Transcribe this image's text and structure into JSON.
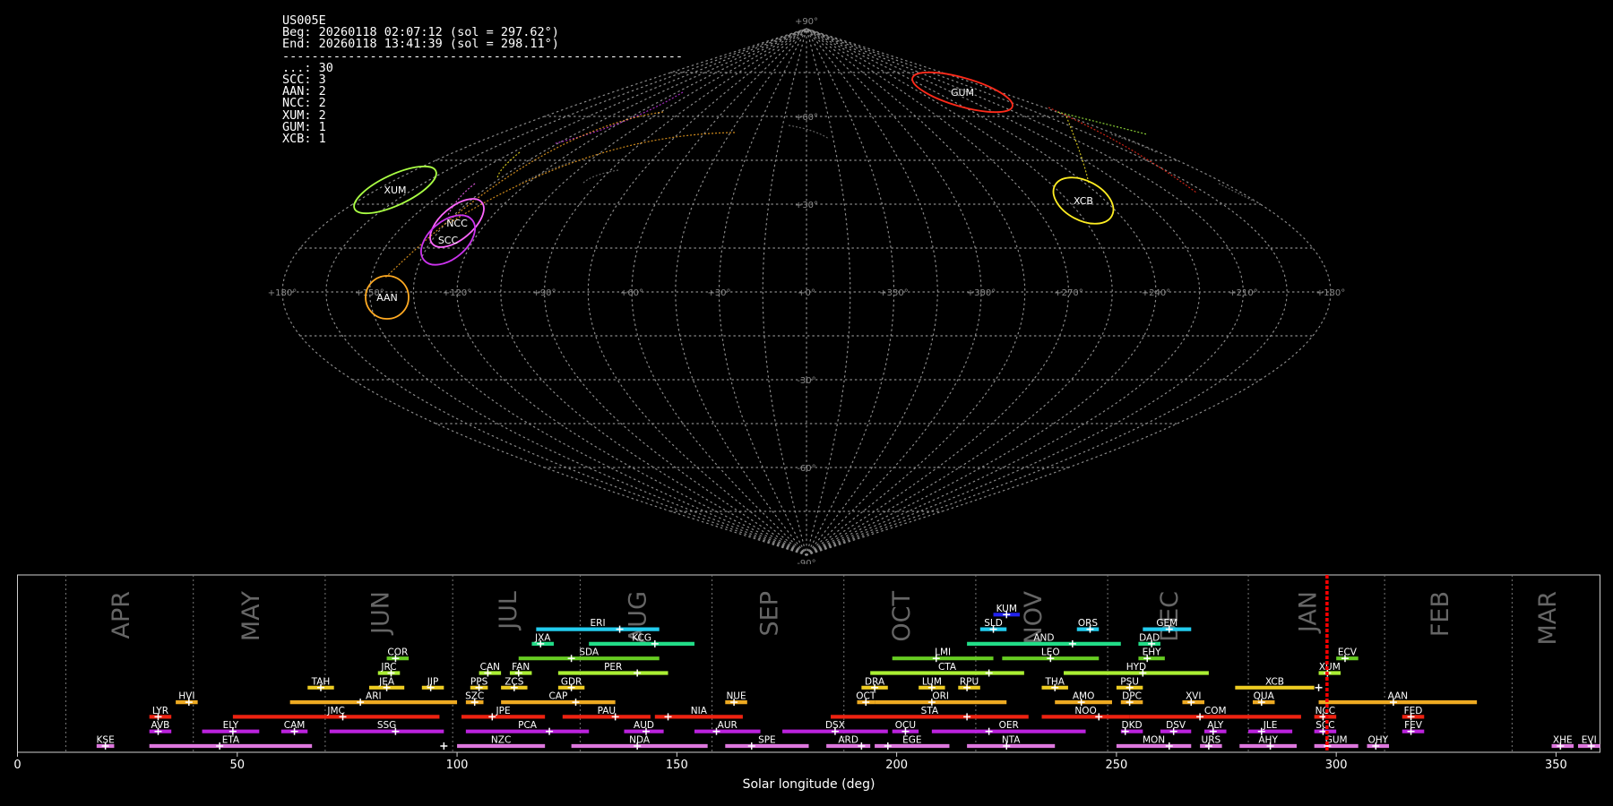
{
  "info": {
    "station": "US005E",
    "begin": "Beg: 20260118 02:07:12 (sol = 297.62°)",
    "end": "End: 20260118 13:41:39 (sol = 298.11°)",
    "separator": "-------------------------------------------------------",
    "counts": [
      {
        "code": "...",
        "count": 30
      },
      {
        "code": "SCC",
        "count": 3
      },
      {
        "code": "AAN",
        "count": 2
      },
      {
        "code": "NCC",
        "count": 2
      },
      {
        "code": "XUM",
        "count": 2
      },
      {
        "code": "GUM",
        "count": 1
      },
      {
        "code": "XCB",
        "count": 1
      }
    ]
  },
  "colors": {
    "background": "#000000",
    "grid": "#8a8a8a",
    "GUM": "#ff2a1a",
    "XCB": "#ffee22",
    "XUM": "#aaff44",
    "NCC": "#ff66ff",
    "SCC": "#cc33ee",
    "AAN": "#ffaa22",
    "sporadic": "#777777",
    "current": "#ff0000"
  },
  "sky_map": {
    "projection": "sinusoidal",
    "lon_labels": [
      "+180°",
      "+150°",
      "+120°",
      "+90°",
      "+60°",
      "+30°",
      "+0°",
      "+330°",
      "+300°",
      "+270°",
      "+240°",
      "+210°",
      "+180°"
    ],
    "lat_labels": [
      "+90°",
      "+60°",
      "+30°",
      "-30°",
      "-60°",
      "-90°"
    ],
    "showers": [
      {
        "code": "GUM",
        "lon": 238,
        "lat": 56
      },
      {
        "code": "XCB",
        "lon": 221,
        "lat": 27
      },
      {
        "code": "XUM",
        "lon": 163,
        "lat": 31
      },
      {
        "code": "NCC",
        "lon": 138,
        "lat": 18
      },
      {
        "code": "SCC",
        "lon": 140,
        "lat": 14
      },
      {
        "code": "AAN",
        "lon": 145,
        "lat": -1
      }
    ]
  },
  "chart_data": {
    "type": "timeline",
    "xlabel": "Solar longitude (deg)",
    "xlim": [
      0,
      360
    ],
    "xticks": [
      0,
      50,
      100,
      150,
      200,
      250,
      300,
      350
    ],
    "current_sol": 297.9,
    "months": [
      {
        "name": "APR",
        "start": 11
      },
      {
        "name": "MAY",
        "start": 40
      },
      {
        "name": "JUN",
        "start": 70
      },
      {
        "name": "JUL",
        "start": 99
      },
      {
        "name": "AUG",
        "start": 128
      },
      {
        "name": "SEP",
        "start": 158
      },
      {
        "name": "OCT",
        "start": 188
      },
      {
        "name": "NOV",
        "start": 218
      },
      {
        "name": "DEC",
        "start": 248
      },
      {
        "name": "JAN",
        "start": 280
      },
      {
        "name": "FEB",
        "start": 311
      },
      {
        "name": "MAR",
        "start": 340
      }
    ],
    "showers": [
      {
        "code": "KUM",
        "start": 222,
        "end": 228,
        "peak": 225,
        "row": 10,
        "color": "#2222ee"
      },
      {
        "code": "ERI",
        "start": 118,
        "end": 146,
        "peak": 137,
        "row": 9,
        "color": "#22ccee"
      },
      {
        "code": "SLD",
        "start": 219,
        "end": 225,
        "peak": 222,
        "row": 9,
        "color": "#22ccee"
      },
      {
        "code": "ORS",
        "start": 241,
        "end": 246,
        "peak": 244,
        "row": 9,
        "color": "#22ccee"
      },
      {
        "code": "GEM",
        "start": 256,
        "end": 267,
        "peak": 262,
        "row": 9,
        "color": "#22ccee"
      },
      {
        "code": "JXA",
        "start": 117,
        "end": 122,
        "peak": 119,
        "row": 8,
        "color": "#22dd88"
      },
      {
        "code": "KCG",
        "start": 130,
        "end": 154,
        "peak": 145,
        "row": 8,
        "color": "#22dd88"
      },
      {
        "code": "AND",
        "start": 216,
        "end": 251,
        "peak": 240,
        "row": 8,
        "color": "#22dd88"
      },
      {
        "code": "DAD",
        "start": 255,
        "end": 260,
        "peak": 258,
        "row": 8,
        "color": "#22dd88"
      },
      {
        "code": "COR",
        "start": 84,
        "end": 89,
        "peak": 86,
        "row": 7,
        "color": "#66cc22"
      },
      {
        "code": "SDA",
        "start": 114,
        "end": 146,
        "peak": 126,
        "row": 7,
        "color": "#66cc22"
      },
      {
        "code": "LMI",
        "start": 199,
        "end": 222,
        "peak": 209,
        "row": 7,
        "color": "#66cc22"
      },
      {
        "code": "LEO",
        "start": 224,
        "end": 246,
        "peak": 235,
        "row": 7,
        "color": "#66cc22"
      },
      {
        "code": "EHY",
        "start": 255,
        "end": 261,
        "peak": 257,
        "row": 7,
        "color": "#66cc22"
      },
      {
        "code": "ECV",
        "start": 300,
        "end": 305,
        "peak": 302,
        "row": 7,
        "color": "#66cc22"
      },
      {
        "code": "JRC",
        "start": 82,
        "end": 87,
        "peak": 85,
        "row": 6,
        "color": "#aaee33"
      },
      {
        "code": "CAN",
        "start": 105,
        "end": 110,
        "peak": 107,
        "row": 6,
        "color": "#aaee33"
      },
      {
        "code": "FAN",
        "start": 112,
        "end": 117,
        "peak": 114,
        "row": 6,
        "color": "#aaee33"
      },
      {
        "code": "PER",
        "start": 123,
        "end": 148,
        "peak": 141,
        "row": 6,
        "color": "#aaee33"
      },
      {
        "code": "CTA",
        "start": 194,
        "end": 229,
        "peak": 221,
        "row": 6,
        "color": "#aaee33"
      },
      {
        "code": "HYD",
        "start": 238,
        "end": 271,
        "peak": 256,
        "row": 6,
        "color": "#aaee33"
      },
      {
        "code": "XUM",
        "start": 296,
        "end": 301,
        "peak": 298,
        "row": 6,
        "color": "#aaee33"
      },
      {
        "code": "TAH",
        "start": 66,
        "end": 72,
        "peak": 69,
        "row": 5,
        "color": "#eecc22"
      },
      {
        "code": "JEA",
        "start": 80,
        "end": 88,
        "peak": 84,
        "row": 5,
        "color": "#eecc22"
      },
      {
        "code": "JIP",
        "start": 92,
        "end": 97,
        "peak": 94,
        "row": 5,
        "color": "#eecc22"
      },
      {
        "code": "PPS",
        "start": 103,
        "end": 107,
        "peak": 105,
        "row": 5,
        "color": "#eecc22"
      },
      {
        "code": "ZCS",
        "start": 110,
        "end": 116,
        "peak": 113,
        "row": 5,
        "color": "#eecc22"
      },
      {
        "code": "GDR",
        "start": 123,
        "end": 129,
        "peak": 126,
        "row": 5,
        "color": "#eecc22"
      },
      {
        "code": "DRA",
        "start": 192,
        "end": 198,
        "peak": 195,
        "row": 5,
        "color": "#eecc22"
      },
      {
        "code": "LUM",
        "start": 205,
        "end": 211,
        "peak": 208,
        "row": 5,
        "color": "#eecc22"
      },
      {
        "code": "RPU",
        "start": 214,
        "end": 219,
        "peak": 216,
        "row": 5,
        "color": "#eecc22"
      },
      {
        "code": "THA",
        "start": 233,
        "end": 239,
        "peak": 236,
        "row": 5,
        "color": "#eecc22"
      },
      {
        "code": "PSU",
        "start": 250,
        "end": 256,
        "peak": 253,
        "row": 5,
        "color": "#eecc22"
      },
      {
        "code": "XCB",
        "start": 277,
        "end": 295,
        "peak": 296,
        "row": 5,
        "color": "#eecc22"
      },
      {
        "code": "HVI",
        "start": 36,
        "end": 41,
        "peak": 39,
        "row": 4,
        "color": "#eeaa22"
      },
      {
        "code": "ARI",
        "start": 62,
        "end": 100,
        "peak": 78,
        "row": 4,
        "color": "#eeaa22"
      },
      {
        "code": "SZC",
        "start": 102,
        "end": 106,
        "peak": 104,
        "row": 4,
        "color": "#eeaa22"
      },
      {
        "code": "CAP",
        "start": 110,
        "end": 136,
        "peak": 127,
        "row": 4,
        "color": "#eeaa22"
      },
      {
        "code": "NUE",
        "start": 161,
        "end": 166,
        "peak": 163,
        "row": 4,
        "color": "#eeaa22"
      },
      {
        "code": "OCT",
        "start": 191,
        "end": 195,
        "peak": 193,
        "row": 4,
        "color": "#eeaa22"
      },
      {
        "code": "ORI",
        "start": 195,
        "end": 225,
        "peak": 208,
        "row": 4,
        "color": "#eeaa22"
      },
      {
        "code": "AMO",
        "start": 236,
        "end": 249,
        "peak": 242,
        "row": 4,
        "color": "#eeaa22"
      },
      {
        "code": "DPC",
        "start": 251,
        "end": 256,
        "peak": 253,
        "row": 4,
        "color": "#eeaa22"
      },
      {
        "code": "XVI",
        "start": 265,
        "end": 270,
        "peak": 267,
        "row": 4,
        "color": "#eeaa22"
      },
      {
        "code": "QUA",
        "start": 281,
        "end": 286,
        "peak": 283,
        "row": 4,
        "color": "#eeaa22"
      },
      {
        "code": "AAN",
        "start": 296,
        "end": 332,
        "peak": 313,
        "row": 4,
        "color": "#eeaa22"
      },
      {
        "code": "LYR",
        "start": 30,
        "end": 35,
        "peak": 32,
        "row": 3,
        "color": "#ee2211"
      },
      {
        "code": "JMC",
        "start": 49,
        "end": 96,
        "peak": 74,
        "row": 3,
        "color": "#ee2211"
      },
      {
        "code": "JPE",
        "start": 101,
        "end": 120,
        "peak": 108,
        "row": 3,
        "color": "#ee2211"
      },
      {
        "code": "PAU",
        "start": 124,
        "end": 144,
        "peak": 136,
        "row": 3,
        "color": "#ee2211"
      },
      {
        "code": "NIA",
        "start": 145,
        "end": 165,
        "peak": 148,
        "row": 3,
        "color": "#ee2211"
      },
      {
        "code": "STA",
        "start": 185,
        "end": 230,
        "peak": 216,
        "row": 3,
        "color": "#ee2211"
      },
      {
        "code": "NOO",
        "start": 233,
        "end": 253,
        "peak": 246,
        "row": 3,
        "color": "#ee2211"
      },
      {
        "code": "COM",
        "start": 253,
        "end": 292,
        "peak": 269,
        "row": 3,
        "color": "#ee2211"
      },
      {
        "code": "NCC",
        "start": 295,
        "end": 300,
        "peak": 297,
        "row": 3,
        "color": "#ee2211"
      },
      {
        "code": "FED",
        "start": 315,
        "end": 320,
        "peak": 317,
        "row": 3,
        "color": "#ee2211"
      },
      {
        "code": "AVB",
        "start": 30,
        "end": 35,
        "peak": 32,
        "row": 2,
        "color": "#bb22dd"
      },
      {
        "code": "ELY",
        "start": 42,
        "end": 55,
        "peak": 49,
        "row": 2,
        "color": "#bb22dd"
      },
      {
        "code": "CAM",
        "start": 60,
        "end": 66,
        "peak": 63,
        "row": 2,
        "color": "#bb22dd"
      },
      {
        "code": "SSG",
        "start": 71,
        "end": 97,
        "peak": 86,
        "row": 2,
        "color": "#bb22dd"
      },
      {
        "code": "PCA",
        "start": 102,
        "end": 130,
        "peak": 121,
        "row": 2,
        "color": "#bb22dd"
      },
      {
        "code": "AUD",
        "start": 138,
        "end": 147,
        "peak": 143,
        "row": 2,
        "color": "#bb22dd"
      },
      {
        "code": "AUR",
        "start": 154,
        "end": 169,
        "peak": 159,
        "row": 2,
        "color": "#bb22dd"
      },
      {
        "code": "DSX",
        "start": 174,
        "end": 198,
        "peak": 186,
        "row": 2,
        "color": "#bb22dd"
      },
      {
        "code": "OCU",
        "start": 199,
        "end": 205,
        "peak": 202,
        "row": 2,
        "color": "#bb22dd"
      },
      {
        "code": "OER",
        "start": 208,
        "end": 243,
        "peak": 221,
        "row": 2,
        "color": "#bb22dd"
      },
      {
        "code": "DKD",
        "start": 251,
        "end": 256,
        "peak": 252,
        "row": 2,
        "color": "#bb22dd"
      },
      {
        "code": "DSV",
        "start": 260,
        "end": 267,
        "peak": 263,
        "row": 2,
        "color": "#bb22dd"
      },
      {
        "code": "ALY",
        "start": 270,
        "end": 275,
        "peak": 272,
        "row": 2,
        "color": "#bb22dd"
      },
      {
        "code": "JLE",
        "start": 280,
        "end": 290,
        "peak": 283,
        "row": 2,
        "color": "#bb22dd"
      },
      {
        "code": "SCC",
        "start": 295,
        "end": 300,
        "peak": 297,
        "row": 2,
        "color": "#bb22dd"
      },
      {
        "code": "FEV",
        "start": 315,
        "end": 320,
        "peak": 317,
        "row": 2,
        "color": "#bb22dd"
      },
      {
        "code": "KSE",
        "start": 18,
        "end": 22,
        "peak": 20,
        "row": 1,
        "color": "#dd77dd"
      },
      {
        "code": "ETA",
        "start": 30,
        "end": 67,
        "peak": 46,
        "row": 1,
        "color": "#dd77dd"
      },
      {
        "code": "NZC",
        "start": 100,
        "end": 120,
        "peak": 97,
        "row": 1,
        "color": "#dd77dd"
      },
      {
        "code": "NDA",
        "start": 126,
        "end": 157,
        "peak": 141,
        "row": 1,
        "color": "#dd77dd"
      },
      {
        "code": "SPE",
        "start": 161,
        "end": 180,
        "peak": 167,
        "row": 1,
        "color": "#dd77dd"
      },
      {
        "code": "ARD",
        "start": 184,
        "end": 194,
        "peak": 192,
        "row": 1,
        "color": "#dd77dd"
      },
      {
        "code": "EGE",
        "start": 195,
        "end": 212,
        "peak": 198,
        "row": 1,
        "color": "#dd77dd"
      },
      {
        "code": "NTA",
        "start": 216,
        "end": 236,
        "peak": 225,
        "row": 1,
        "color": "#dd77dd"
      },
      {
        "code": "MON",
        "start": 250,
        "end": 267,
        "peak": 262,
        "row": 1,
        "color": "#dd77dd"
      },
      {
        "code": "URS",
        "start": 269,
        "end": 274,
        "peak": 271,
        "row": 1,
        "color": "#dd77dd"
      },
      {
        "code": "AHY",
        "start": 278,
        "end": 291,
        "peak": 285,
        "row": 1,
        "color": "#dd77dd"
      },
      {
        "code": "GUM",
        "start": 295,
        "end": 305,
        "peak": 298,
        "row": 1,
        "color": "#dd77dd"
      },
      {
        "code": "OHY",
        "start": 307,
        "end": 312,
        "peak": 309,
        "row": 1,
        "color": "#dd77dd"
      },
      {
        "code": "XHE",
        "start": 349,
        "end": 354,
        "peak": 351,
        "row": 1,
        "color": "#dd77dd"
      },
      {
        "code": "EVI",
        "start": 355,
        "end": 360,
        "peak": 358,
        "row": 1,
        "color": "#dd77dd"
      }
    ]
  }
}
